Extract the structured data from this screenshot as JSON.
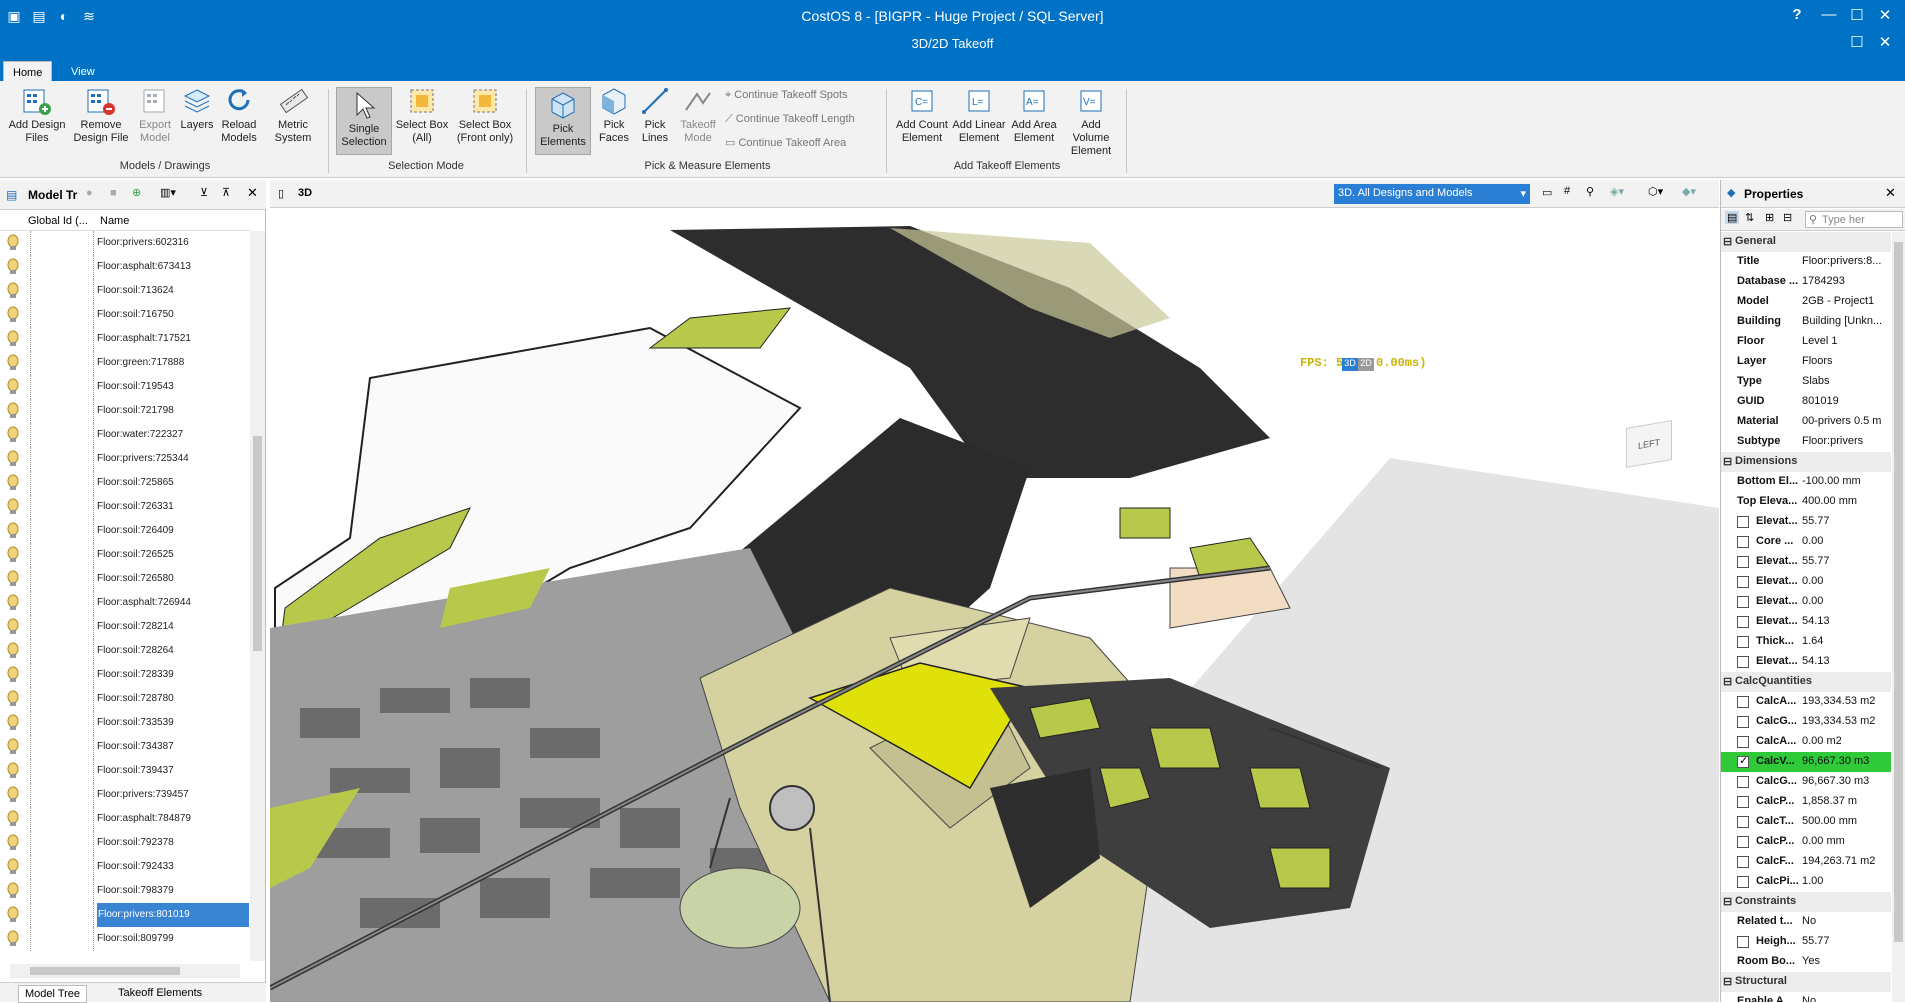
{
  "titlebar": {
    "title": "CostOS 8 - [BIGPR - Huge Project  / SQL Server]",
    "subtitle": "3D/2D Takeoff",
    "help": "?",
    "minimize": "—",
    "maximize": "☐",
    "close": "✕"
  },
  "tabs": [
    "Home",
    "View"
  ],
  "ribbon": {
    "models": {
      "label": "Models / Drawings",
      "buttons": [
        "Add Design Files",
        "Remove Design File",
        "Export Model",
        "Layers",
        "Reload Models",
        "Metric System"
      ]
    },
    "selection": {
      "label": "Selection Mode",
      "buttons": [
        "Single Selection",
        "Select Box (All)",
        "Select Box (Front only)"
      ]
    },
    "pick": {
      "label": "Pick & Measure Elements",
      "buttons": [
        "Pick Elements",
        "Pick Faces",
        "Pick Lines",
        "Takeoff Mode"
      ],
      "continue": [
        "Continue Takeoff Spots",
        "Continue Takeoff Length",
        "Continue Takeoff Area"
      ]
    },
    "takeoff": {
      "label": "Add Takeoff Elements",
      "buttons": [
        "Add Count Element",
        "Add Linear Element",
        "Add Area Element",
        "Add Volume Element"
      ]
    }
  },
  "left_panel": {
    "title": "Model Tr",
    "col_global": "Global Id (...",
    "col_name": "Name",
    "selected_index": 28,
    "rows": [
      "Floor:privers:602316",
      "Floor:asphalt:673413",
      "Floor:soil:713624",
      "Floor:soil:716750",
      "Floor:asphalt:717521",
      "Floor:green:717888",
      "Floor:soil:719543",
      "Floor:soil:721798",
      "Floor:water:722327",
      "Floor:privers:725344",
      "Floor:soil:725865",
      "Floor:soil:726331",
      "Floor:soil:726409",
      "Floor:soil:726525",
      "Floor:soil:726580",
      "Floor:asphalt:726944",
      "Floor:soil:728214",
      "Floor:soil:728264",
      "Floor:soil:728339",
      "Floor:soil:728780",
      "Floor:soil:733539",
      "Floor:soil:734387",
      "Floor:soil:739437",
      "Floor:privers:739457",
      "Floor:asphalt:784879",
      "Floor:soil:792378",
      "Floor:soil:792433",
      "Floor:soil:798379",
      "Floor:privers:801019",
      "Floor:soil:809799"
    ],
    "bottom_tabs": [
      "Model Tree",
      "Takeoff Elements"
    ]
  },
  "view": {
    "tab": "3D",
    "dropdown": "3D. All Designs and Models",
    "fps": "FPS: 5",
    "fps_tail": "0.00ms)",
    "btn3d": "3D",
    "btn2d": "2D",
    "cube": "LEFT"
  },
  "properties": {
    "title": "Properties",
    "search_placeholder": "Type her",
    "sections": {
      "general": "General",
      "dimensions": "Dimensions",
      "calc": "CalcQuantities",
      "constraints": "Constraints",
      "structural": "Structural"
    },
    "general": [
      [
        "Title",
        "Floor:privers:8..."
      ],
      [
        "Database ...",
        "1784293"
      ],
      [
        "Model",
        "2GB - Project1"
      ],
      [
        "Building",
        "Building [Unkn..."
      ],
      [
        "Floor",
        "Level 1"
      ],
      [
        "Layer",
        "Floors"
      ],
      [
        "Type",
        "Slabs"
      ],
      [
        "GUID",
        "801019"
      ],
      [
        "Material",
        "00-privers 0.5 m"
      ],
      [
        "Subtype",
        "Floor:privers"
      ]
    ],
    "dimensions": [
      [
        "Bottom El...",
        "-100.00 mm"
      ],
      [
        "Top Eleva...",
        "400.00 mm"
      ],
      [
        "Elevat...",
        "55.77"
      ],
      [
        "Core ...",
        "0.00"
      ],
      [
        "Elevat...",
        "55.77"
      ],
      [
        "Elevat...",
        "0.00"
      ],
      [
        "Elevat...",
        "0.00"
      ],
      [
        "Elevat...",
        "54.13"
      ],
      [
        "Thick...",
        "1.64"
      ],
      [
        "Elevat...",
        "54.13"
      ]
    ],
    "calc": [
      [
        "CalcA...",
        "193,334.53 m2"
      ],
      [
        "CalcG...",
        "193,334.53 m2"
      ],
      [
        "CalcA...",
        "0.00 m2"
      ],
      [
        "CalcV...",
        "96,667.30 m3"
      ],
      [
        "CalcG...",
        "96,667.30 m3"
      ],
      [
        "CalcP...",
        "1,858.37 m"
      ],
      [
        "CalcT...",
        "500.00 mm"
      ],
      [
        "CalcP...",
        "0.00 mm"
      ],
      [
        "CalcF...",
        "194,263.71 m2"
      ],
      [
        "CalcPi...",
        "1.00"
      ]
    ],
    "constraints": [
      [
        "Related t...",
        "No"
      ],
      [
        "Heigh...",
        "55.77"
      ],
      [
        "Room Bo...",
        "Yes"
      ]
    ],
    "structural": [
      [
        "Enable A...",
        "No"
      ]
    ]
  }
}
